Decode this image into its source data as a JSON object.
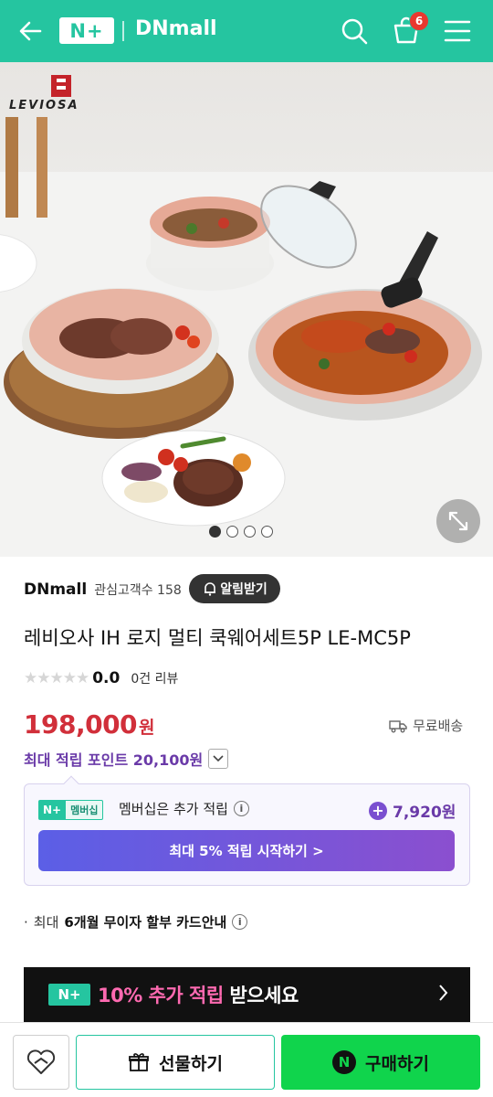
{
  "header": {
    "logo_text": "N+",
    "store_name": "DNmall",
    "cart_count": "6"
  },
  "hero": {
    "brand_logo_text": "LEVIOSA",
    "slide_count": 4,
    "active_slide": 1
  },
  "store": {
    "name": "DNmall",
    "fans_label": "관심고객수 158",
    "alarm_label": "알림받기"
  },
  "product": {
    "title": "레비오사 IH 로지 멀티 쿡웨어세트5P LE-MC5P",
    "rating": "0.0",
    "review_count": "0건 리뷰",
    "price": "198,000",
    "currency": "원",
    "shipping": "무료배송",
    "max_points": "최대 적립 포인트 20,100원"
  },
  "membership": {
    "tag_logo": "N+",
    "tag_label": "멤버십",
    "text": "멤버십은 추가 적립",
    "points": "7,920원",
    "cta": "최대 5% 적립 시작하기 >"
  },
  "installment": {
    "prefix": "최대",
    "bold": "6개월 무이자 할부 카드안내"
  },
  "promo": {
    "logo": "N+",
    "highlight": "10% 추가 적립",
    "rest": " 받으세요"
  },
  "bottom_bar": {
    "gift_label": "선물하기",
    "buy_label": "구매하기",
    "buy_logo": "N"
  },
  "colors": {
    "brand_green": "#25c5a0",
    "price_red": "#d12f3a",
    "point_purple": "#6a3aa8",
    "buy_green": "#10d44c"
  }
}
